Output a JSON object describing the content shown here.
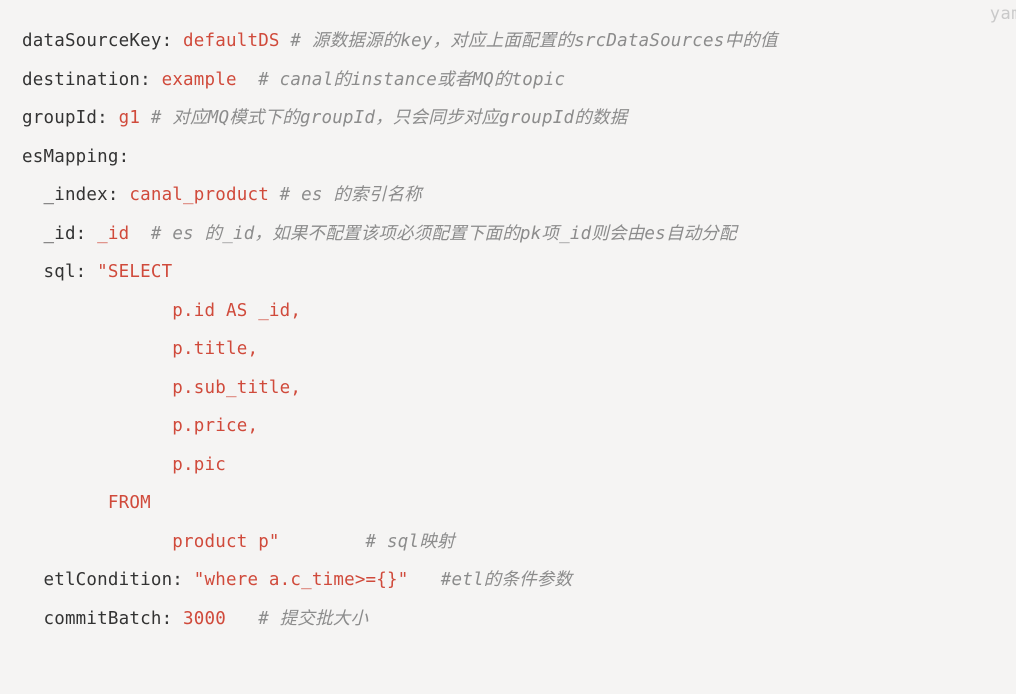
{
  "lang_tag": "yam",
  "lines": {
    "l1_key": "dataSourceKey:",
    "l1_val": " defaultDS",
    "l1_cmt": " # 源数据源的key，对应上面配置的srcDataSources中的值",
    "l2_key": "destination:",
    "l2_val": " example",
    "l2_cmt": "  # canal的instance或者MQ的topic",
    "l3_key": "groupId:",
    "l3_val": " g1",
    "l3_cmt": " # 对应MQ模式下的groupId，只会同步对应groupId的数据",
    "l4_key": "esMapping:",
    "l5_key": "  _index:",
    "l5_val": " canal_product",
    "l5_cmt": " # es 的索引名称",
    "l6_key": "  _id:",
    "l6_val": " _id",
    "l6_cmt": "  # es 的_id，如果不配置该项必须配置下面的pk项_id则会由es自动分配",
    "l7_key": "  sql:",
    "l7_val": " \"SELECT",
    "l8_val": "              p.id AS _id,",
    "l9_val": "              p.title,",
    "l10_val": "              p.sub_title,",
    "l11_val": "              p.price,",
    "l12_val": "              p.pic",
    "l13_val": "        FROM",
    "l14_val": "              product p\"",
    "l14_cmt": "        # sql映射",
    "l15_key": "  etlCondition:",
    "l15_val": " \"where a.c_time>={}\"",
    "l15_cmt": "   #etl的条件参数",
    "l16_key": "  commitBatch:",
    "l16_val": " 3000",
    "l16_cmt": "   # 提交批大小"
  }
}
